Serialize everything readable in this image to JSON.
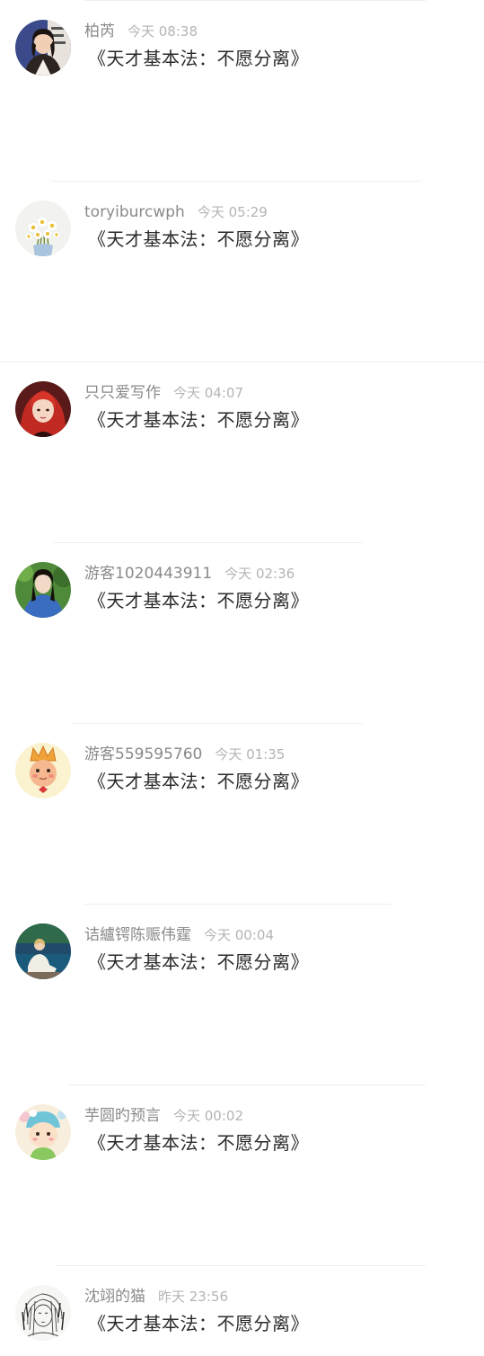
{
  "comments": [
    {
      "username": "柏芮",
      "time": "今天 08:38",
      "text": "《天才基本法：不愿分离》",
      "avatar": "woman-in-blazer-avatar"
    },
    {
      "username": "toryiburcwph",
      "time": "今天 05:29",
      "text": "《天才基本法：不愿分离》",
      "avatar": "daisy-flowers-avatar"
    },
    {
      "username": "只只爱写作",
      "time": "今天 04:07",
      "text": "《天才基本法：不愿分离》",
      "avatar": "red-hair-girl-avatar"
    },
    {
      "username": "游客1020443911",
      "time": "今天 02:36",
      "text": "《天才基本法：不愿分离》",
      "avatar": "girl-blue-denim-avatar"
    },
    {
      "username": "游客559595760",
      "time": "今天 01:35",
      "text": "《天才基本法：不愿分离》",
      "avatar": "cartoon-crown-avatar"
    },
    {
      "username": "诘纑锷陈赈伟霆",
      "time": "今天 00:04",
      "text": "《天才基本法：不愿分离》",
      "avatar": "lakeside-girl-avatar"
    },
    {
      "username": "芋圆旳预言",
      "time": "今天 00:02",
      "text": "《天才基本法：不愿分离》",
      "avatar": "cartoon-bunny-avatar"
    },
    {
      "username": "沈翊的猫",
      "time": "昨天 23:56",
      "text": "《天才基本法：不愿分离》",
      "avatar": "sketch-girl-avatar"
    }
  ]
}
